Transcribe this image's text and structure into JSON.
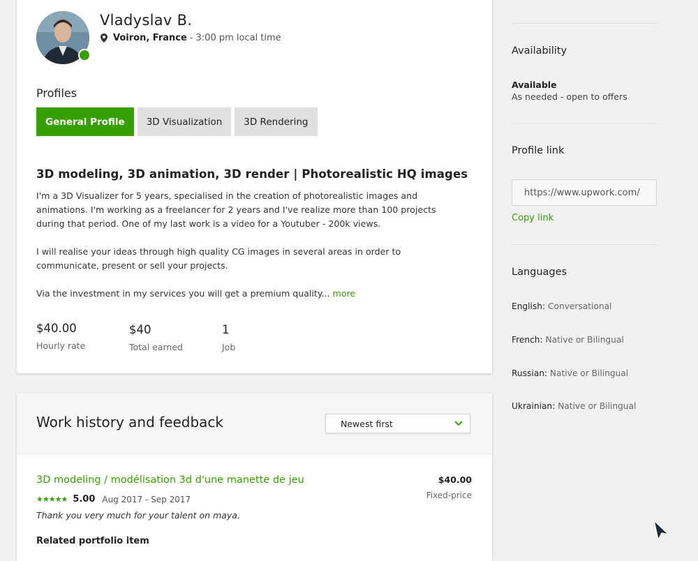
{
  "profile": {
    "name": "Vladyslav B.",
    "city": "Voiron, France",
    "local_time": "3:00 pm local time",
    "online_color": "#37a000",
    "profiles_title": "Profiles",
    "tabs": [
      {
        "label": "General Profile",
        "active": true
      },
      {
        "label": "3D Visualization",
        "active": false
      },
      {
        "label": "3D Rendering",
        "active": false
      }
    ],
    "headline": "3D modeling, 3D animation, 3D render | Photorealistic HQ images",
    "description": {
      "p1": "I'm a 3D Visualizer for 5 years, specialised in the creation of photorealistic images and animations. I'm working as a freelancer for 2 years and I've realize more than 100 projects during that period. One of my last work is a video for a Youtuber - 200k views.",
      "p2": "I will realise your ideas through high quality CG images in several areas in order to communicate, present or sell your projects.",
      "p3": "Via the investment in my services you will get a premium quality...",
      "more": "more"
    },
    "stats": [
      {
        "value": "$40.00",
        "label": "Hourly rate"
      },
      {
        "value": "$40",
        "label": "Total earned"
      },
      {
        "value": "1",
        "label": "Job"
      }
    ]
  },
  "work_history": {
    "title": "Work history and feedback",
    "sort_selected": "Newest first",
    "jobs": [
      {
        "title": "3D modeling / modélisation 3d d'une manette de jeu",
        "price": "$40.00",
        "type": "Fixed-price",
        "stars": "★★★★★",
        "rating": 5.0,
        "score": "5.00",
        "dates": "Aug 2017 - Sep 2017",
        "feedback": "Thank you very much for your talent on maya.",
        "related_label": "Related portfolio item"
      }
    ]
  },
  "sidebar": {
    "availability_title": "Availability",
    "availability_status": "Available",
    "availability_detail": "As needed - open to offers",
    "profile_link_title": "Profile link",
    "profile_link_value": "https://www.upwork.com/",
    "copy_link": "Copy link",
    "languages_title": "Languages",
    "languages": [
      {
        "name": "English:",
        "level": "Conversational"
      },
      {
        "name": "French:",
        "level": "Native or Bilingual"
      },
      {
        "name": "Russian:",
        "level": "Native or Bilingual"
      },
      {
        "name": "Ukrainian:",
        "level": "Native or Bilingual"
      }
    ]
  },
  "colors": {
    "brand_green": "#37a000"
  }
}
